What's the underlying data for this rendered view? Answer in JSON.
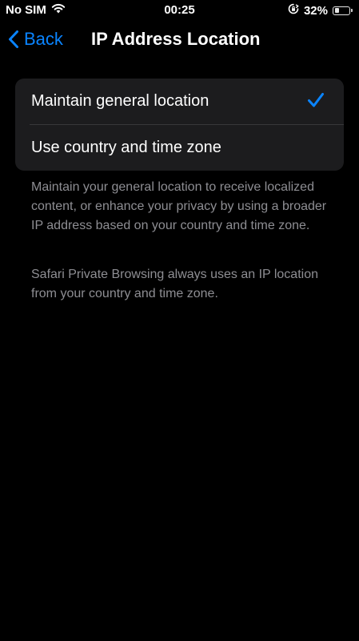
{
  "status_bar": {
    "carrier": "No SIM",
    "time": "00:25",
    "battery_percent": "32%",
    "battery_level": 0.32,
    "icons": [
      "wifi-icon",
      "orientation-lock-icon",
      "battery-icon"
    ]
  },
  "nav": {
    "back_label": "Back",
    "title": "IP Address Location"
  },
  "options": [
    {
      "label": "Maintain general location",
      "selected": true
    },
    {
      "label": "Use country and time zone",
      "selected": false
    }
  ],
  "footer": {
    "paragraph1": "Maintain your general location to receive localized content, or enhance your privacy by using a broader IP address based on your country and time zone.",
    "paragraph2": "Safari Private Browsing always uses an IP location from your country and time zone."
  },
  "colors": {
    "accent": "#0a84ff",
    "background": "#000000",
    "group_background": "#1c1c1e",
    "secondary_text": "#8e8e93"
  }
}
